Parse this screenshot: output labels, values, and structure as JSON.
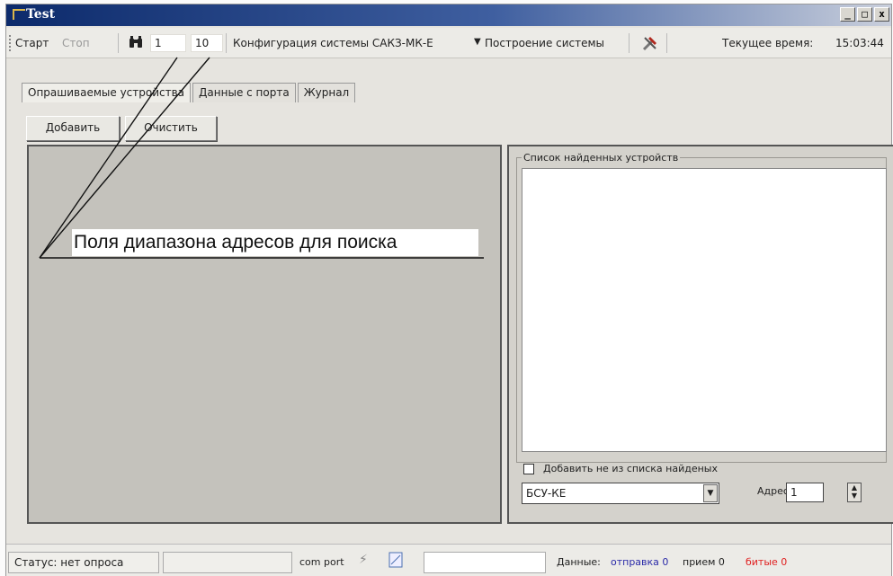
{
  "window": {
    "title": "Test",
    "minimize": "_",
    "maximize": "□",
    "close": "x"
  },
  "toolbar": {
    "start_label": "Старт",
    "stop_label": "Стоп",
    "search_icon": "binoculars-icon",
    "range_from": "1",
    "range_to": "10",
    "config_label": "Конфигурация системы САКЗ-МК-Е",
    "build_label": "Построение системы",
    "tools_icon": "tools-icon",
    "time_label": "Текущее время:",
    "time_value": "15:03:44"
  },
  "tabs": [
    {
      "label": "Опрашиваемые устройства",
      "active": true
    },
    {
      "label": "Данные с порта",
      "active": false
    },
    {
      "label": "Журнал",
      "active": false
    }
  ],
  "actions": {
    "add_label": "Добавить",
    "clear_label": "Очистить"
  },
  "annotation": {
    "text": "Поля диапазона адресов для поиска"
  },
  "found_devices": {
    "caption": "Список найденных устройств",
    "add_not_from_list_label": "Добавить не из списка найденых",
    "device_type": "БСУ-КЕ",
    "address_label": "Адрес",
    "address_value": "1"
  },
  "status": {
    "status_text": "Статус: нет опроса",
    "com_port_label": "com port",
    "data_label": "Данные:",
    "sent_text": "отправка 0",
    "received_text": "прием 0",
    "broken_text": "битые 0"
  },
  "colors": {
    "sent": "#2a2aa8",
    "received": "#222222",
    "broken": "#e02020"
  }
}
